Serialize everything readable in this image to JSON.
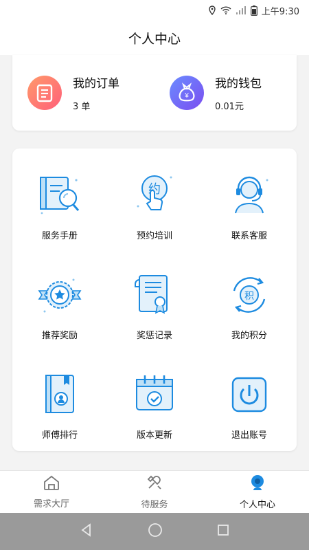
{
  "status_bar": {
    "time": "上午9:30"
  },
  "header": {
    "title": "个人中心"
  },
  "summary": {
    "orders": {
      "label": "我的订单",
      "value": "3 单"
    },
    "wallet": {
      "label": "我的钱包",
      "value": "0.01元",
      "icon_text": "¥"
    }
  },
  "menu": {
    "items": [
      {
        "label": "服务手册",
        "icon": "manual-icon"
      },
      {
        "label": "预约培训",
        "icon": "appointment-icon",
        "icon_text": "约"
      },
      {
        "label": "联系客服",
        "icon": "customer-service-icon"
      },
      {
        "label": "推荐奖励",
        "icon": "award-badge-icon"
      },
      {
        "label": "奖惩记录",
        "icon": "certificate-icon"
      },
      {
        "label": "我的积分",
        "icon": "points-icon",
        "icon_text": "积"
      },
      {
        "label": "师傅排行",
        "icon": "ranking-book-icon"
      },
      {
        "label": "版本更新",
        "icon": "calendar-update-icon"
      },
      {
        "label": "退出账号",
        "icon": "power-icon"
      }
    ]
  },
  "tabs": [
    {
      "label": "需求大厅",
      "icon": "home-icon"
    },
    {
      "label": "待服务",
      "icon": "service-icon"
    },
    {
      "label": "个人中心",
      "icon": "profile-icon",
      "active": true
    }
  ],
  "colors": {
    "accent": "#1d8be0",
    "nav_bar": "#9a9a9a"
  }
}
